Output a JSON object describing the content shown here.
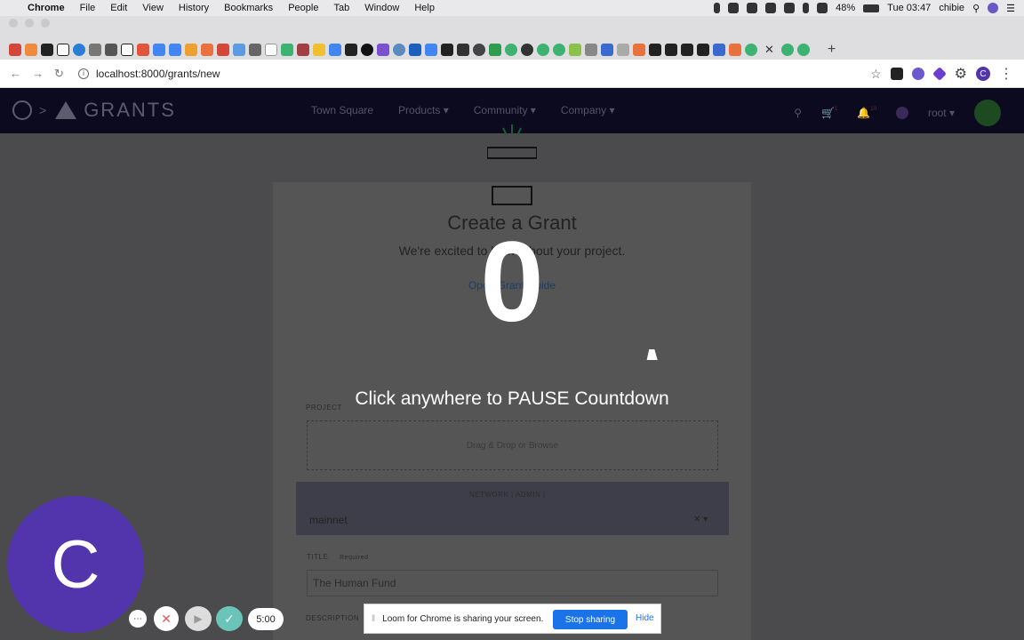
{
  "menubar": {
    "app": "Chrome",
    "items": [
      "File",
      "Edit",
      "View",
      "History",
      "Bookmarks",
      "People",
      "Tab",
      "Window",
      "Help"
    ],
    "battery": "48%",
    "clock": "Tue 03:47",
    "user": "chibie"
  },
  "browser": {
    "url": "localhost:8000/grants/new",
    "profile_initial": "C"
  },
  "site": {
    "brand": "GRANTS",
    "nav": [
      "Town Square",
      "Products",
      "Community",
      "Company"
    ],
    "user_name": "root",
    "cart_badge": "1",
    "bell_badge": "10"
  },
  "form": {
    "title": "Create a Grant",
    "subtitle": "We're excited to learn about your project.",
    "guide_link": "Open Grant Guide",
    "project_label": "PROJECT",
    "drop_text": "Drag & Drop or Browse",
    "network_label": "NETWORK | ADMIN |",
    "network_value": "mainnet",
    "title_label": "TITLE",
    "title_required": "Required",
    "title_value": "The Human Fund",
    "description_label": "DESCRIPTION"
  },
  "overlay": {
    "countdown": "0",
    "message": "Click anywhere to PAUSE Countdown"
  },
  "loom": {
    "avatar_initial": "C",
    "timer": "5:00",
    "share_text": "Loom for Chrome is sharing your screen.",
    "stop_label": "Stop sharing",
    "hide_label": "Hide"
  },
  "colors": {
    "loom_purple": "#5234ad",
    "stop_blue": "#1a73e8",
    "nav_dark": "#0b0a1e"
  }
}
